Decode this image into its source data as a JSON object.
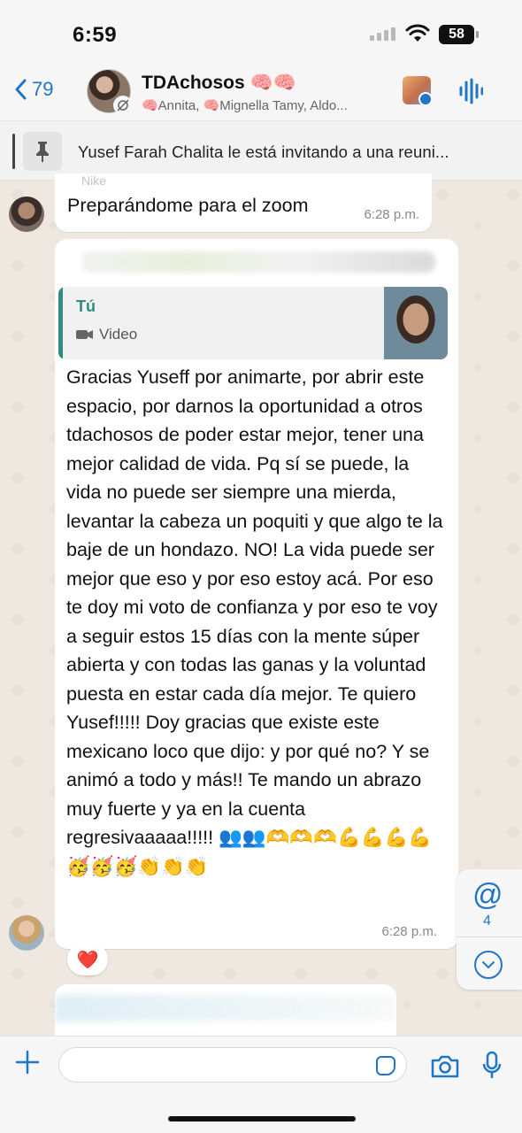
{
  "status_bar": {
    "time": "6:59",
    "battery": "58"
  },
  "header": {
    "back_count": "79",
    "title": "TDAchosos 🧠🧠",
    "subtitle": "🧠Annita, 🧠Mignella Tamy, Aldo..."
  },
  "pinned": {
    "text": "Yusef Farah Chalita le está invitando a una reuni..."
  },
  "messages": [
    {
      "sender_partial": "Nike",
      "text": "Preparándome para el zoom",
      "time": "6:28 p.m."
    },
    {
      "quote": {
        "author": "Tú",
        "type": "Video"
      },
      "text": "Gracias Yuseff por animarte, por abrir este espacio, por darnos la oportunidad a otros tdachosos de poder estar mejor, tener una mejor calidad de vida. Pq sí se puede, la vida no puede ser siempre una mierda, levantar la cabeza un poquiti y que algo te la baje de un hondazo. NO! La vida puede ser mejor que eso y por eso estoy acá. Por eso te doy mi voto de confianza y por eso te voy a seguir estos 15 días con la mente súper abierta y con todas las ganas y la voluntad puesta en estar cada día mejor. Te quiero Yusef!!!!! Doy gracias que existe este mexicano loco que dijo: y por qué no? Y se animó a todo y más!! Te mando un abrazo muy fuerte y ya en la cuenta regresivaaaaa!!!!! 👥👥🫶🫶🫶💪💪💪💪🥳🥳🥳👏👏👏",
      "time": "6:28 p.m.",
      "reaction": "❤️"
    }
  ],
  "floating": {
    "mention_symbol": "@",
    "mention_count": "4"
  },
  "icons": {
    "back": "chevron-left-icon",
    "pin": "pin-icon",
    "audio": "audio-wave-icon",
    "plus": "plus-icon",
    "sticker": "sticker-icon",
    "camera": "camera-icon",
    "mic": "microphone-icon"
  },
  "colors": {
    "accent": "#1f76c7",
    "quote_accent": "#2e8c82",
    "background": "#efe9e2"
  }
}
